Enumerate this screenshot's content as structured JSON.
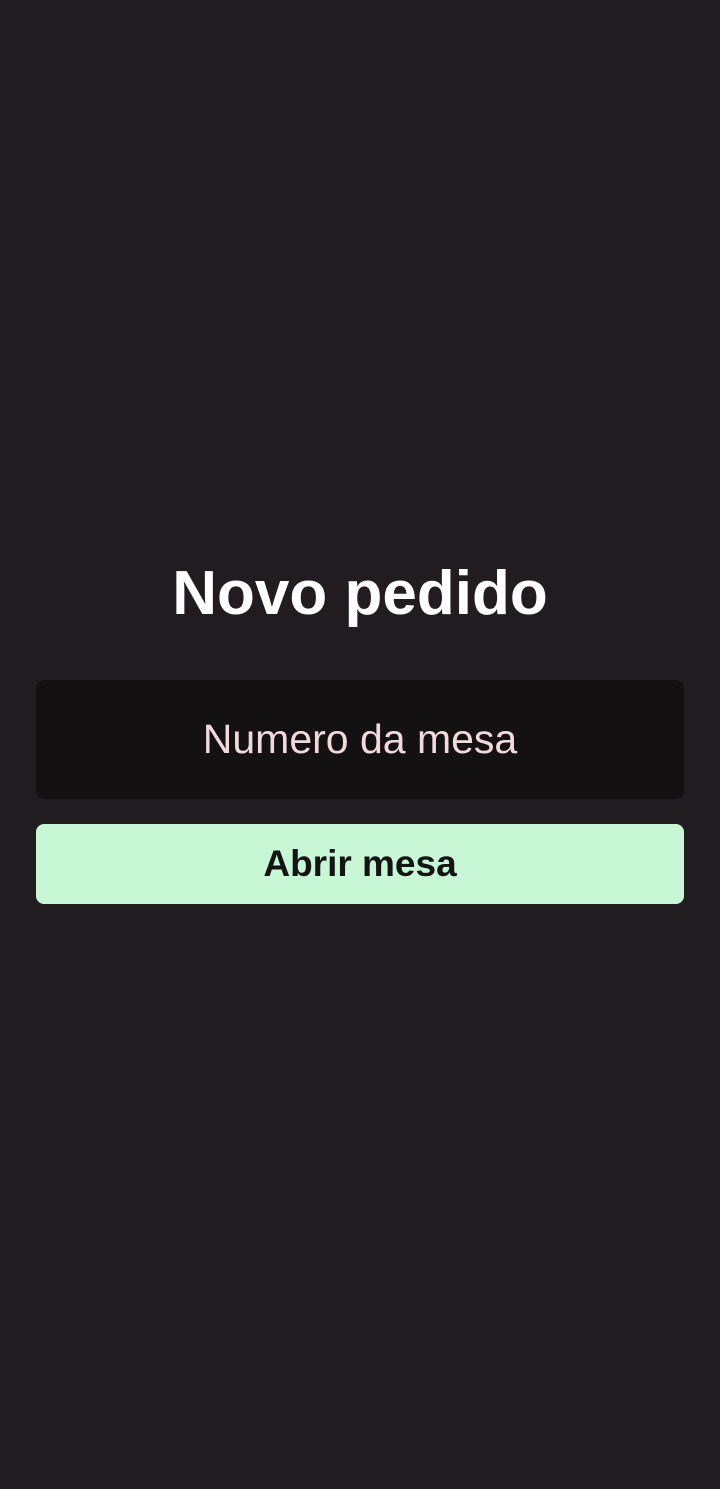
{
  "page": {
    "title": "Novo pedido"
  },
  "form": {
    "table_number": {
      "value": "",
      "placeholder": "Numero da mesa"
    },
    "submit_label": "Abrir mesa"
  },
  "colors": {
    "background": "#201c1f",
    "input_background": "#141113",
    "input_text": "#f1d9dc",
    "button_background": "#c7f7d4",
    "button_text": "#141414",
    "title_text": "#ffffff"
  }
}
